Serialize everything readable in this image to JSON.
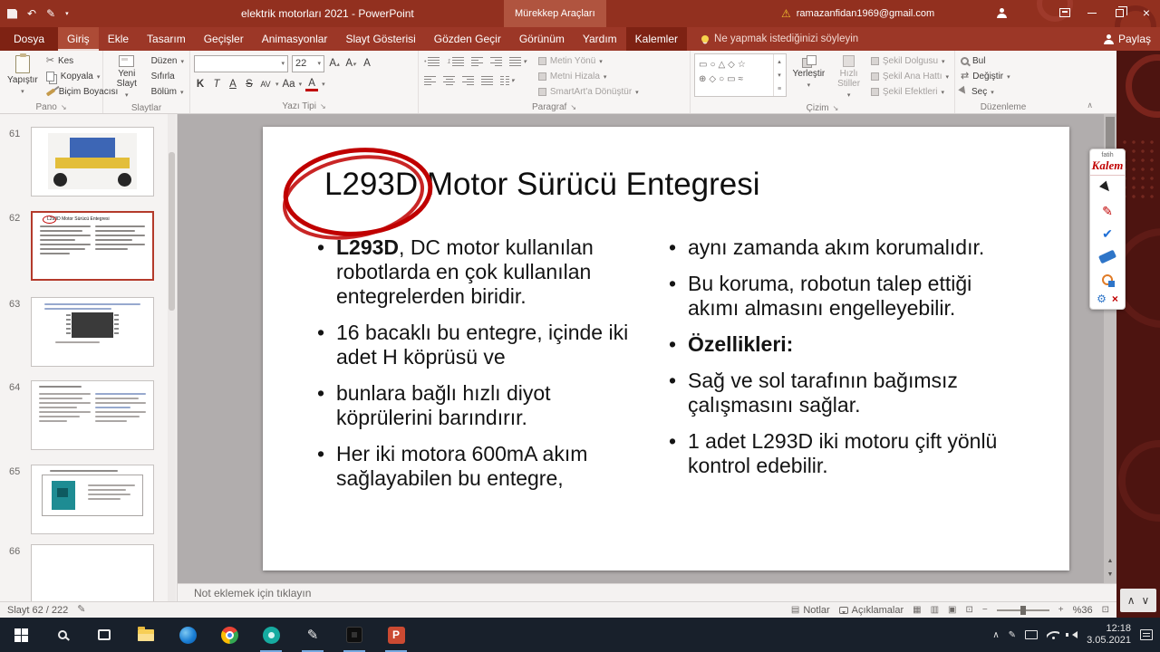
{
  "window": {
    "title": "elektrik motorları 2021 - PowerPoint",
    "contextual_header": "Mürekkep Araçları",
    "account_email": "ramazanfidan1969@gmail.com"
  },
  "tabs": [
    "Dosya",
    "Giriş",
    "Ekle",
    "Tasarım",
    "Geçişler",
    "Animasyonlar",
    "Slayt Gösterisi",
    "Gözden Geçir",
    "Görünüm",
    "Yardım",
    "Kalemler"
  ],
  "tellme": "Ne yapmak istediğinizi söyleyin",
  "share": "Paylaş",
  "ribbon": {
    "paste": "Yapıştır",
    "cut": "Kes",
    "copy": "Kopyala",
    "format_painter": "Biçim Boyacısı",
    "group_clipboard": "Pano",
    "new_slide": "Yeni Slayt",
    "layout": "Düzen",
    "reset": "Sıfırla",
    "section": "Bölüm",
    "group_slides": "Slaytlar",
    "font_size": "22",
    "bold": "K",
    "italic": "T",
    "underline": "A",
    "strikethrough": "S",
    "char_spacing": "AV",
    "change_case": "Aa",
    "font_color": "A",
    "group_font": "Yazı Tipi",
    "text_direction": "Metin Yönü",
    "align_text": "Metni Hizala",
    "convert_smartart": "SmartArt'a Dönüştür",
    "group_paragraph": "Paragraf",
    "arrange": "Yerleştir",
    "quick_styles": "Hızlı Stiller",
    "shape_fill": "Şekil Dolgusu",
    "shape_outline": "Şekil Ana Hattı",
    "shape_effects": "Şekil Efektleri",
    "group_drawing": "Çizim",
    "find": "Bul",
    "replace": "Değiştir",
    "select": "Seç",
    "group_editing": "Düzenleme"
  },
  "slide": {
    "title": "L293D Motor Sürücü Entegresi",
    "left_bullets": [
      {
        "bold": "L293D",
        "text": ", DC motor kullanılan robotlarda en çok kullanılan entegrelerden biridir."
      },
      {
        "text": "16 bacaklı bu entegre, içinde iki adet H köprüsü ve"
      },
      {
        "text": "bunlara bağlı hızlı diyot köprülerini barındırır."
      },
      {
        "text": "Her iki motora 600mA akım sağlayabilen bu entegre,"
      }
    ],
    "right_bullets": [
      {
        "text": "aynı zamanda akım korumalıdır."
      },
      {
        "text": "Bu koruma, robotun talep ettiği akımı almasını engelleyebilir."
      },
      {
        "bold": "Özellikleri:"
      },
      {
        "text": "Sağ ve sol tarafının bağımsız çalışmasını sağlar."
      },
      {
        "text": "1 adet L293D iki motoru çift yönlü kontrol edebilir."
      }
    ]
  },
  "thumbnails": [
    {
      "number": "61"
    },
    {
      "number": "62",
      "selected": true
    },
    {
      "number": "63"
    },
    {
      "number": "64"
    },
    {
      "number": "65"
    },
    {
      "number": "66"
    }
  ],
  "notes": {
    "placeholder": "Not eklemek için tıklayın"
  },
  "status": {
    "slide_indicator": "Slayt 62 / 222",
    "notes_btn": "Notlar",
    "comments_btn": "Açıklamalar",
    "zoom": "%36"
  },
  "taskbar": {
    "time": "12:18",
    "date": "3.05.2021"
  },
  "palette": {
    "brand_top": "fatih",
    "brand": "Kalem"
  },
  "colors": {
    "titlebar": "#92301F",
    "desktop": "#4D1410",
    "annotation": "#C00000",
    "selection_border": "#B43A2B"
  }
}
